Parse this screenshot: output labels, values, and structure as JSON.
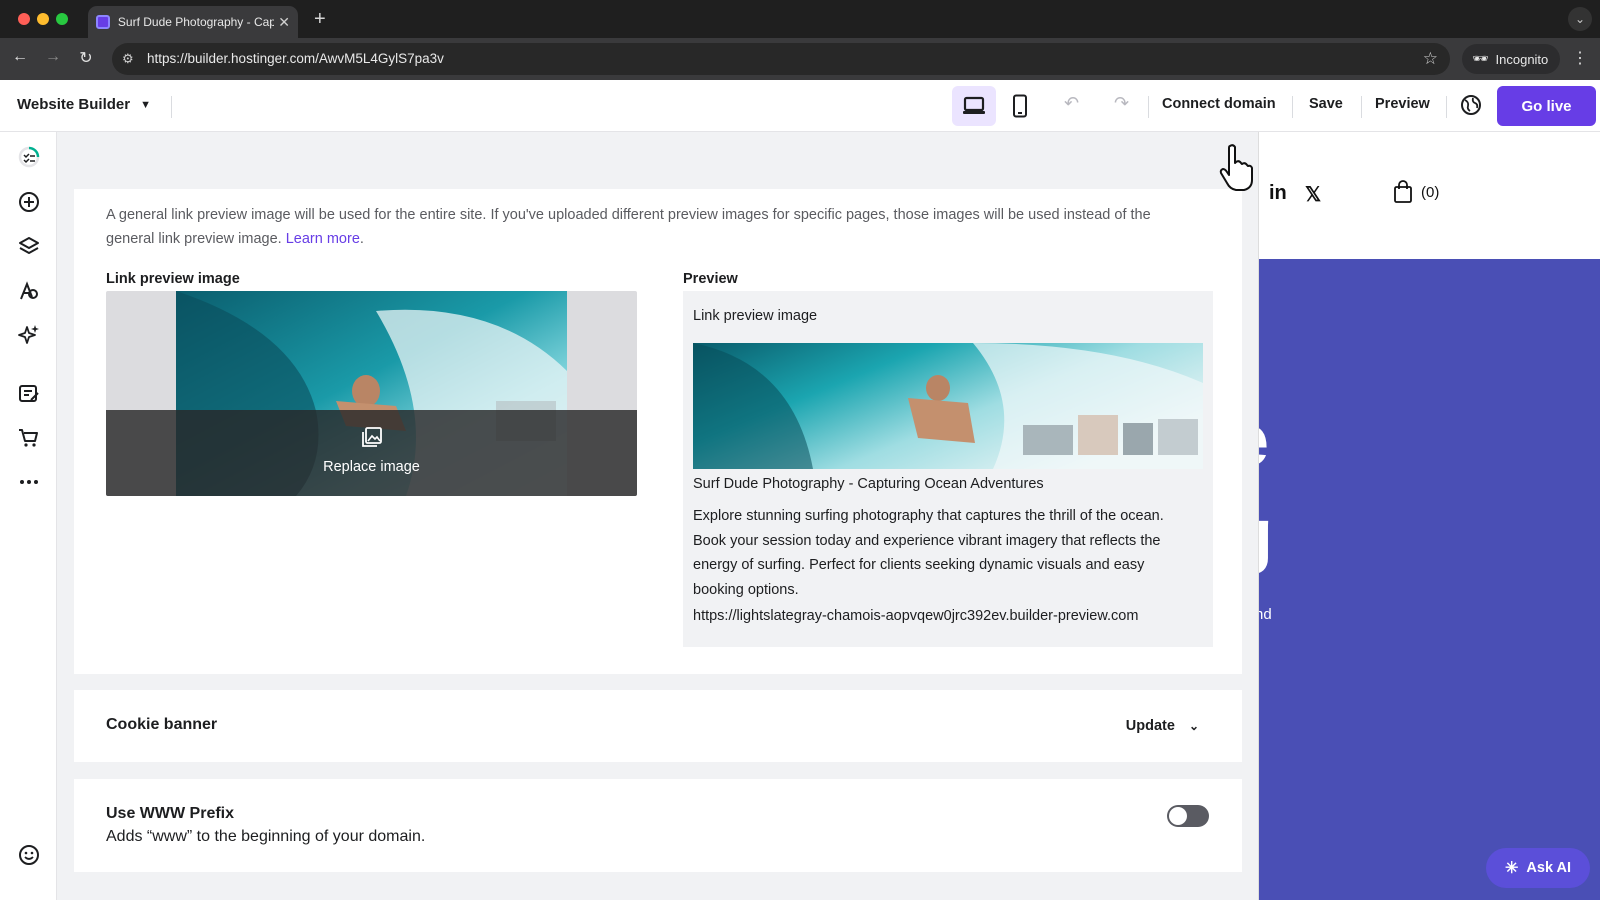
{
  "browser": {
    "tab_title": "Surf Dude Photography - Capturing Ocean Adventures",
    "url": "https://builder.hostinger.com/AwvM5L4GylS7pa3v",
    "incognito_label": "Incognito"
  },
  "header": {
    "brand": "Website Builder",
    "connect_domain": "Connect domain",
    "save": "Save",
    "preview": "Preview",
    "go_live": "Go live"
  },
  "sidebar": {
    "items": [
      "checklist-icon",
      "add-icon",
      "layers-icon",
      "styles-icon",
      "ai-tools-icon",
      "blog-icon",
      "store-icon",
      "more-icon",
      "support-icon"
    ]
  },
  "link_preview": {
    "intro": "A general link preview image will be used for the entire site. If you've uploaded different preview images for specific pages, those images will be used instead of the general link preview image.",
    "learn_more": "Learn more",
    "image_label": "Link preview image",
    "replace_label": "Replace image",
    "preview_heading": "Preview",
    "preview_label": "Link preview image",
    "preview_title": "Surf Dude Photography - Capturing Ocean Adventures",
    "preview_description": "Explore stunning surfing photography that captures the thrill of the ocean. Book your session today and experience vibrant imagery that reflects the energy of surfing. Perfect for clients seeking dynamic visuals and easy booking options.",
    "preview_url": "https://lightslategray-chamois-aopvqew0jrc392ev.builder-preview.com"
  },
  "cookie_banner": {
    "title": "Cookie banner",
    "action": "Update"
  },
  "www_prefix": {
    "title": "Use WWW Prefix",
    "description": "Adds “www” to the beginning of your domain.",
    "enabled": false
  },
  "site_preview": {
    "social_linkedin": "in",
    "social_x": "𝕏",
    "cart_count": "(0)",
    "headline_fragment_1": "e",
    "headline_fragment_2": "g",
    "text_fragment": "y and"
  },
  "assistant": {
    "label": "Ask AI"
  },
  "colors": {
    "accent": "#673de6",
    "site_background": "#4a4fb5"
  }
}
